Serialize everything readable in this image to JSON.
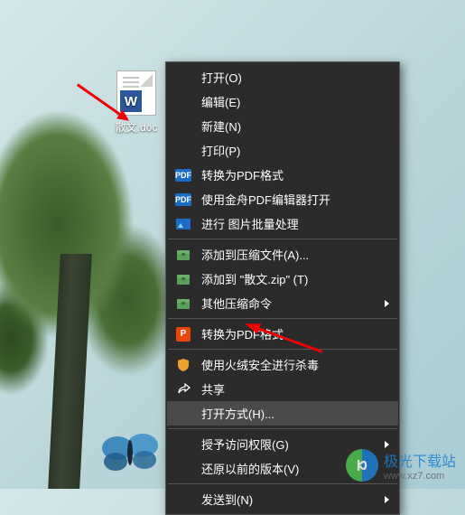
{
  "desktop": {
    "file_label": "散文.doc",
    "word_letter": "W"
  },
  "menu": {
    "open": "打开(O)",
    "edit": "编辑(E)",
    "new": "新建(N)",
    "print": "打印(P)",
    "convert_pdf": "转换为PDF格式",
    "open_jinzhou": "使用金舟PDF编辑器打开",
    "batch_image": "进行 图片批量处理",
    "add_archive": "添加到压缩文件(A)...",
    "add_zip": "添加到 \"散文.zip\" (T)",
    "other_compress": "其他压缩命令",
    "convert_pdf2": "转换为PDF格式",
    "huorong": "使用火绒安全进行杀毒",
    "share": "共享",
    "open_with": "打开方式(H)...",
    "grant_access": "授予访问权限(G)",
    "restore_prev": "还原以前的版本(V)",
    "send_to": "发送到(N)"
  },
  "watermark": {
    "text": "极光下载站",
    "url": "www.xz7.com"
  }
}
